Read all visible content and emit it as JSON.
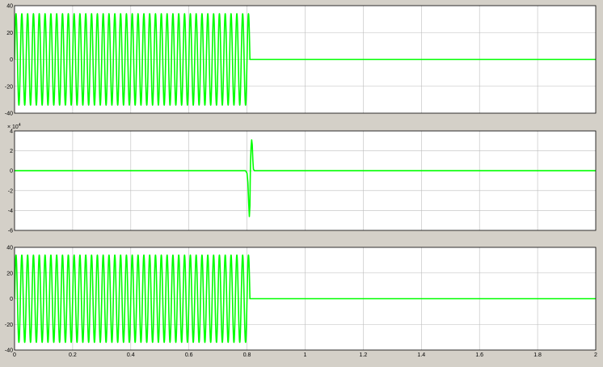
{
  "window": {
    "background": "#d4d0c8",
    "axes_background": "#ffffff",
    "grid_color": "#bdbdbd",
    "trace_color": "#00ff00",
    "grid": true
  },
  "chart_data": [
    {
      "type": "line",
      "title": "",
      "xlabel": "",
      "ylabel": "",
      "xlim": [
        0,
        2
      ],
      "ylim": [
        -40,
        40
      ],
      "xticks": [],
      "yticks": [
        "40",
        "20",
        "0",
        "-20",
        "-40"
      ],
      "series": [
        {
          "kind": "sinusoid-then-zero",
          "frequency_hz": 50,
          "amplitude": 34,
          "cutoff_x": 0.81,
          "value_after_cutoff": 0
        }
      ]
    },
    {
      "type": "line",
      "title": "",
      "xlabel": "",
      "ylabel": "",
      "exponent_label": "× 10",
      "exponent_power": "4",
      "xlim": [
        0,
        2
      ],
      "ylim": [
        -6,
        4
      ],
      "xticks": [],
      "yticks": [
        "4",
        "2",
        "0",
        "-2",
        "-4",
        "-6"
      ],
      "series": [
        {
          "kind": "zero-with-spike",
          "points": [
            [
              0,
              0
            ],
            [
              0.795,
              0
            ],
            [
              0.8,
              -0.25
            ],
            [
              0.803,
              -1.2
            ],
            [
              0.806,
              -3.4
            ],
            [
              0.808,
              -4.6
            ],
            [
              0.81,
              -3.5
            ],
            [
              0.811,
              -1.0
            ],
            [
              0.812,
              0.8
            ],
            [
              0.814,
              2.4
            ],
            [
              0.816,
              3.1
            ],
            [
              0.818,
              2.6
            ],
            [
              0.82,
              1.1
            ],
            [
              0.822,
              0.15
            ],
            [
              0.826,
              0
            ],
            [
              2,
              0
            ]
          ]
        }
      ]
    },
    {
      "type": "line",
      "title": "",
      "xlabel": "",
      "ylabel": "",
      "xlim": [
        0,
        2
      ],
      "ylim": [
        -40,
        40
      ],
      "xticks": [
        "0",
        "0.2",
        "0.4",
        "0.6",
        "0.8",
        "1",
        "1.2",
        "1.4",
        "1.6",
        "1.8",
        "2"
      ],
      "yticks": [
        "40",
        "20",
        "0",
        "-20",
        "-40"
      ],
      "series": [
        {
          "kind": "sinusoid-then-zero",
          "frequency_hz": 50,
          "amplitude": 34,
          "cutoff_x": 0.81,
          "value_after_cutoff": 0
        }
      ]
    }
  ]
}
